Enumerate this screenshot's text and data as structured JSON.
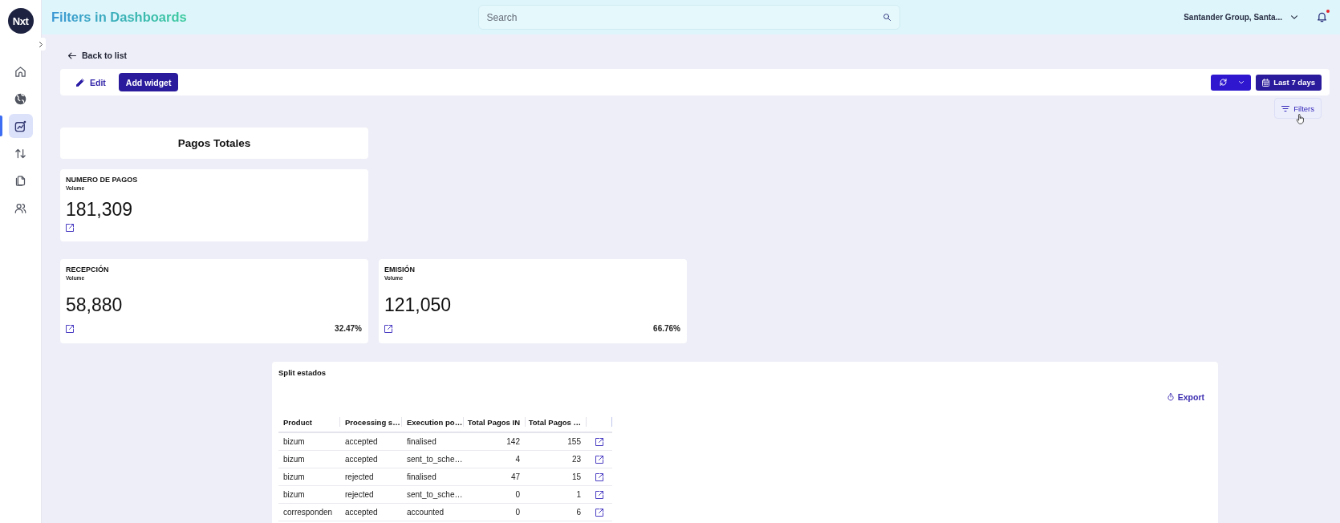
{
  "sidebar": {
    "logo": "Nxt",
    "items": [
      {
        "kind": "home",
        "selected": false
      },
      {
        "kind": "globe",
        "selected": false
      },
      {
        "kind": "chart",
        "selected": true
      },
      {
        "kind": "transfer",
        "selected": false
      },
      {
        "kind": "documents",
        "selected": false
      },
      {
        "kind": "users",
        "selected": false
      }
    ]
  },
  "header": {
    "title": "Filters in Dashboards",
    "search": {
      "placeholder": "Search"
    },
    "account": "Santander Group, Santa...",
    "notifications": {
      "unread": true
    }
  },
  "page": {
    "back_link": "Back to list",
    "toolbar": {
      "edit": "Edit",
      "add_widget": "Add widget",
      "date_range": "Last 7 days"
    },
    "filters": "Filters"
  },
  "section_title": "Pagos Totales",
  "metric_rows": [
    {
      "cards": [
        {
          "title": "NUMERO DE PAGOS",
          "subtitle": "Volume",
          "value": "181,309"
        }
      ]
    },
    {
      "cards": [
        {
          "title": "RECEPCIÓN",
          "subtitle": "Volume",
          "value": "58,880",
          "share": "32.47%"
        },
        {
          "title": "EMISIÓN",
          "subtitle": "Volume",
          "value": "121,050",
          "share": "66.76%"
        }
      ]
    }
  ],
  "table": {
    "title": "Split estados",
    "export": "Export",
    "columns": [
      {
        "label": "Product",
        "kind": "text"
      },
      {
        "label": "Processing s…",
        "kind": "text"
      },
      {
        "label": "Execution po…",
        "kind": "text"
      },
      {
        "label": "Total Pagos IN",
        "kind": "number"
      },
      {
        "label": "Total Pagos …",
        "kind": "number"
      }
    ],
    "rows": [
      [
        "bizum",
        "accepted",
        "finalised",
        "142",
        "155"
      ],
      [
        "bizum",
        "accepted",
        "sent_to_sche…",
        "4",
        "23"
      ],
      [
        "bizum",
        "rejected",
        "finalised",
        "47",
        "15"
      ],
      [
        "bizum",
        "rejected",
        "sent_to_sche…",
        "0",
        "1"
      ],
      [
        "corresponden",
        "accepted",
        "accounted",
        "0",
        "6"
      ]
    ]
  }
}
